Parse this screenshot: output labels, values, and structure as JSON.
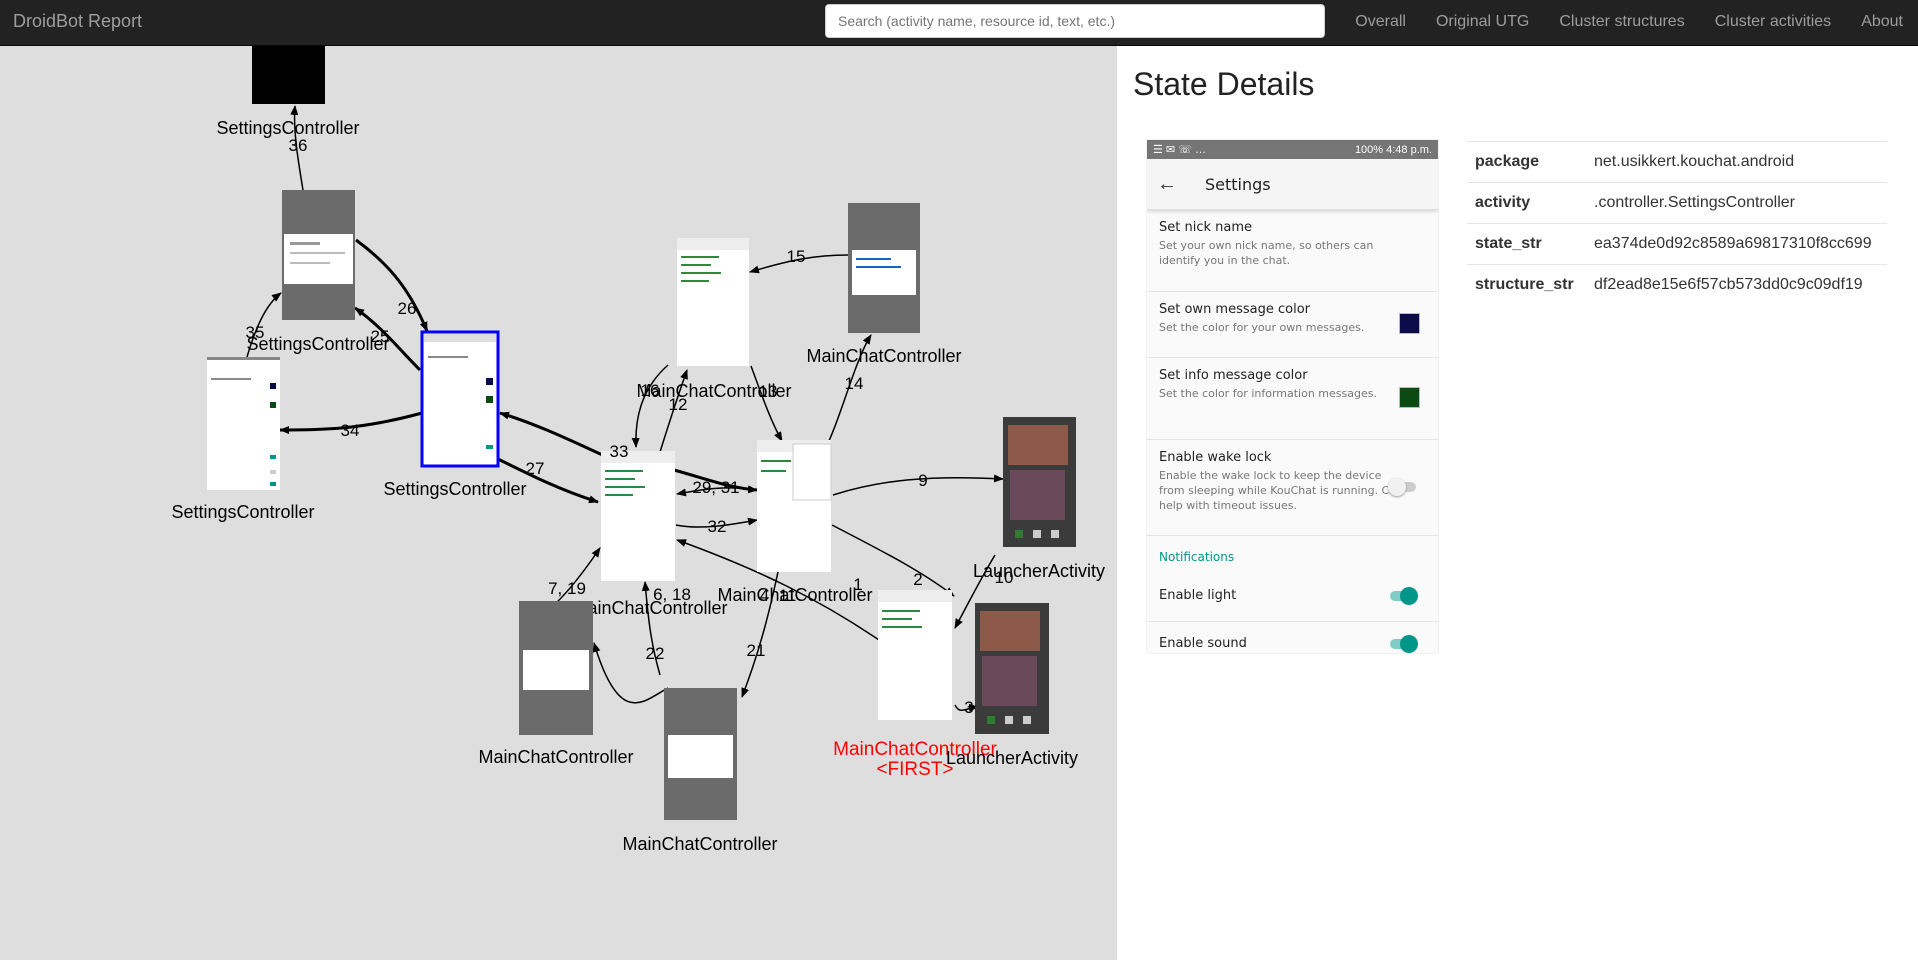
{
  "navbar": {
    "brand": "DroidBot Report",
    "search_placeholder": "Search (activity name, resource id, text, etc.)",
    "links": [
      "Overall",
      "Original UTG",
      "Cluster structures",
      "Cluster activities",
      "About"
    ]
  },
  "graph": {
    "first_marker": "<FIRST>",
    "nodes": [
      {
        "label": "SettingsController"
      },
      {
        "label": "SettingsController"
      },
      {
        "label": "SettingsController"
      },
      {
        "label": "SettingsController"
      },
      {
        "label": "MainChatController"
      },
      {
        "label": "MainChatController"
      },
      {
        "label": "MainChatController"
      },
      {
        "label": "MainChatController"
      },
      {
        "label": "MainChatController"
      },
      {
        "label": "MainChatController"
      },
      {
        "label": "MainChatController"
      },
      {
        "label": "LauncherActivity"
      },
      {
        "label": "LauncherActivity"
      }
    ],
    "edge_labels": [
      "36",
      "26",
      "25",
      "35",
      "34",
      "27",
      "33",
      "29, 31",
      "32",
      "15",
      "16",
      "12",
      "13",
      "14",
      "9",
      "2",
      "1",
      "4, 11",
      "10",
      "3",
      "7, 19",
      "6, 18",
      "22",
      "21"
    ]
  },
  "details": {
    "title": "State Details",
    "screenshot": {
      "status_right": "100% 4:48 p.m.",
      "app_title": "Settings",
      "prefs": [
        {
          "title": "Set nick name",
          "summary": "Set your own nick name, so others can identify you in the chat."
        },
        {
          "title": "Set own message color",
          "summary": "Set the color for your own messages.",
          "swatch": "#0b0b4a"
        },
        {
          "title": "Set info message color",
          "summary": "Set the color for information messages.",
          "swatch": "#0b4a12"
        },
        {
          "title": "Enable wake lock",
          "summary": "Enable the wake lock to keep the device from sleeping while KouChat is running. Can help with timeout issues.",
          "toggle": "off"
        }
      ],
      "category": "Notifications",
      "switches": [
        {
          "title": "Enable light",
          "toggle": "on"
        },
        {
          "title": "Enable sound",
          "toggle": "on"
        }
      ],
      "accent": "#009688"
    },
    "properties": [
      {
        "key": "package",
        "value": "net.usikkert.kouchat.android"
      },
      {
        "key": "activity",
        "value": ".controller.SettingsController"
      },
      {
        "key": "state_str",
        "value": "ea374de0d92c8589a69817310f8cc699"
      },
      {
        "key": "structure_str",
        "value": "df2ead8e15e6f57cb573dd0c9c09df19"
      }
    ]
  }
}
